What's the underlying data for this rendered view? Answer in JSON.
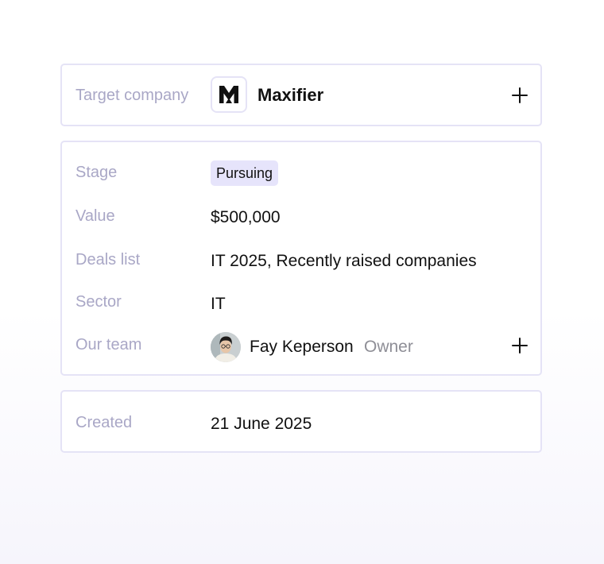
{
  "company": {
    "label": "Target company",
    "name": "Maxifier",
    "logo_icon": "maxifier-m-logo"
  },
  "details": {
    "stage": {
      "label": "Stage",
      "value": "Pursuing",
      "pill_color": "#e6e4fb"
    },
    "value": {
      "label": "Value",
      "value": "$500,000"
    },
    "deals_list": {
      "label": "Deals list",
      "value": "IT 2025, Recently raised companies"
    },
    "sector": {
      "label": "Sector",
      "value": "IT"
    },
    "team": {
      "label": "Our team",
      "member_name": "Fay Keperson",
      "member_role": "Owner"
    }
  },
  "created": {
    "label": "Created",
    "value": "21 June 2025"
  },
  "colors": {
    "label": "#a9a7c6",
    "border": "#e5e3f6",
    "role": "#8e8e96"
  }
}
